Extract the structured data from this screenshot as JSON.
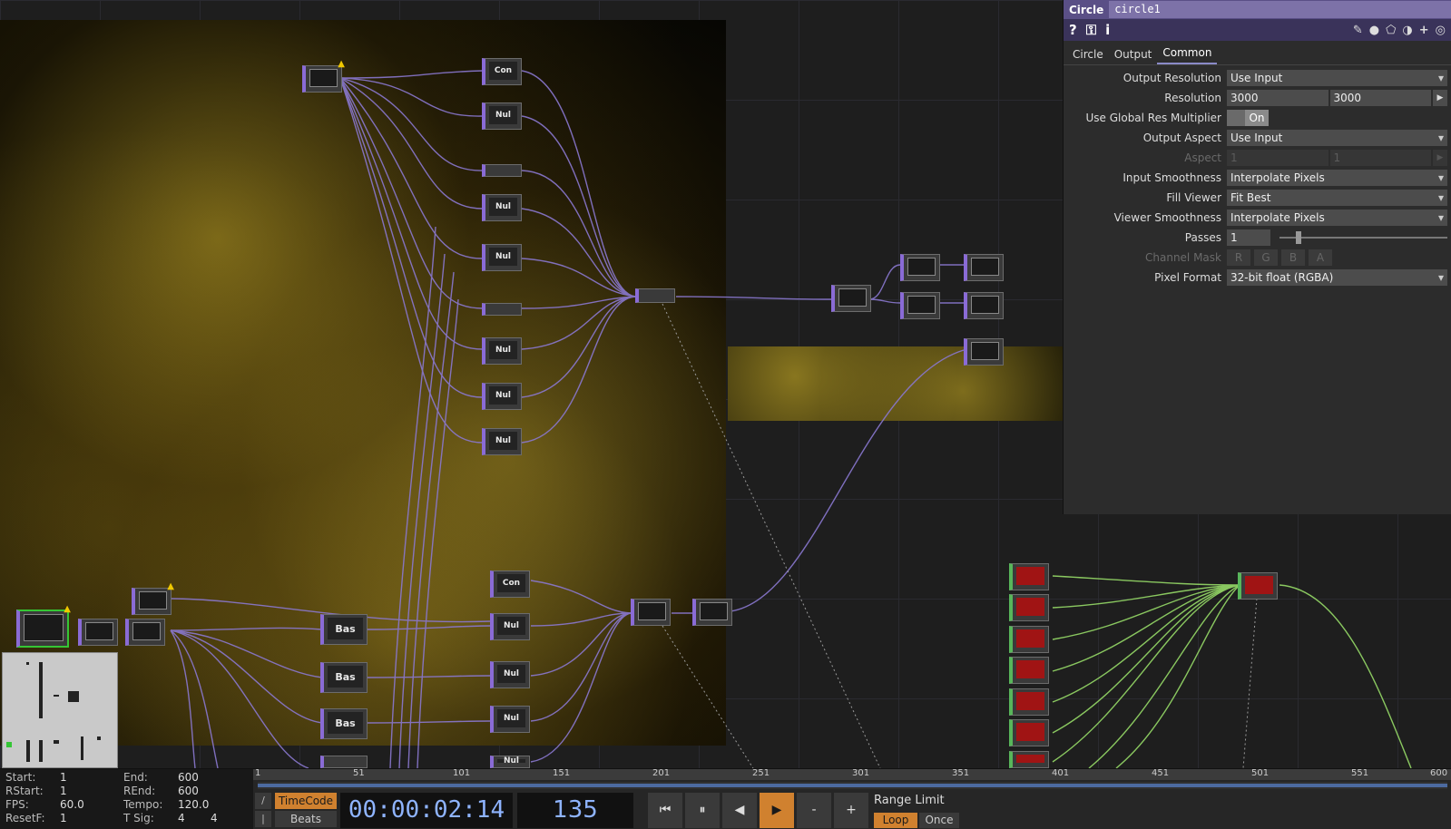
{
  "network": {
    "nodes": [
      {
        "name": "node-top-warning",
        "label": "",
        "type": "top-warn"
      },
      {
        "name": "node-con-1",
        "label": "Con"
      },
      {
        "name": "node-nul-1",
        "label": "Nul"
      },
      {
        "name": "node-nul-2",
        "label": "Nul"
      },
      {
        "name": "node-nul-3",
        "label": "Nul"
      },
      {
        "name": "node-nul-4",
        "label": "Nul"
      },
      {
        "name": "node-nul-5",
        "label": "Nul"
      },
      {
        "name": "node-nul-6",
        "label": "Nul"
      },
      {
        "name": "node-con-2",
        "label": "Con"
      },
      {
        "name": "node-nul-7",
        "label": "Nul"
      },
      {
        "name": "node-nul-8",
        "label": "Nul"
      },
      {
        "name": "node-nul-9",
        "label": "Nul"
      },
      {
        "name": "node-nul-10",
        "label": "Nul"
      },
      {
        "name": "node-bas-1",
        "label": "Bas"
      },
      {
        "name": "node-bas-2",
        "label": "Bas"
      },
      {
        "name": "node-bas-3",
        "label": "Bas"
      }
    ]
  },
  "params": {
    "op_type": "Circle",
    "op_name": "circle1",
    "toolbar": {
      "help": "?",
      "info": "i"
    },
    "tabs": [
      "Circle",
      "Output",
      "Common"
    ],
    "active_tab": "Common",
    "rows": {
      "output_resolution": {
        "label": "Output Resolution",
        "value": "Use Input"
      },
      "resolution": {
        "label": "Resolution",
        "w": "3000",
        "h": "3000"
      },
      "global_res": {
        "label": "Use Global Res Multiplier",
        "value": "On"
      },
      "output_aspect": {
        "label": "Output Aspect",
        "value": "Use Input"
      },
      "aspect": {
        "label": "Aspect",
        "a": "1",
        "b": "1"
      },
      "input_smoothness": {
        "label": "Input Smoothness",
        "value": "Interpolate Pixels"
      },
      "fill_viewer": {
        "label": "Fill Viewer",
        "value": "Fit Best"
      },
      "viewer_smoothness": {
        "label": "Viewer Smoothness",
        "value": "Interpolate Pixels"
      },
      "passes": {
        "label": "Passes",
        "value": "1",
        "level": 0.1
      },
      "channel_mask": {
        "label": "Channel Mask",
        "channels": [
          "R",
          "G",
          "B",
          "A"
        ]
      },
      "pixel_format": {
        "label": "Pixel Format",
        "value": "32-bit float (RGBA)"
      }
    }
  },
  "timeline": {
    "stats": {
      "start_label": "Start:",
      "start": "1",
      "end_label": "End:",
      "end": "600",
      "rstart_label": "RStart:",
      "rstart": "1",
      "rend_label": "REnd:",
      "rend": "600",
      "fps_label": "FPS:",
      "fps": "60.0",
      "tempo_label": "Tempo:",
      "tempo": "120.0",
      "resetf_label": "ResetF:",
      "resetf": "1",
      "tsig_label": "T Sig:",
      "tsig_a": "4",
      "tsig_b": "4"
    },
    "ruler": [
      "1",
      "51",
      "101",
      "151",
      "201",
      "251",
      "301",
      "351",
      "401",
      "451",
      "501",
      "551",
      "600"
    ],
    "timecode_btn": "TimeCode",
    "beats_btn": "Beats",
    "timecode": "00:00:02:14",
    "frame": "135",
    "range_limit": "Range Limit",
    "loop": "Loop",
    "once": "Once",
    "minus": "-",
    "plus": "+"
  }
}
